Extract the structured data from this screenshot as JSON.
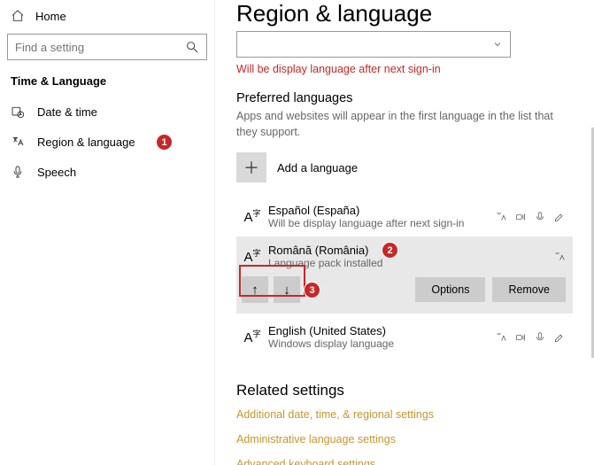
{
  "sidebar": {
    "home": "Home",
    "search_placeholder": "Find a setting",
    "category": "Time & Language",
    "items": [
      {
        "label": "Date & time"
      },
      {
        "label": "Region & language"
      },
      {
        "label": "Speech"
      }
    ]
  },
  "page": {
    "title": "Region & language",
    "dropdown_partial": " ",
    "display_warning": "Will be display language after next sign-in",
    "preferred_title": "Preferred languages",
    "preferred_sub": "Apps and websites will appear in the first language in the list that they support.",
    "add_label": "Add a language",
    "languages": [
      {
        "name": "Español (España)",
        "sub": "Will be display language after next sign-in"
      },
      {
        "name": "Română (România)",
        "sub": "Language pack installed"
      },
      {
        "name": "English (United States)",
        "sub": "Windows display language"
      }
    ],
    "options_btn": "Options",
    "remove_btn": "Remove",
    "related_title": "Related settings",
    "links": [
      "Additional date, time, & regional settings",
      "Administrative language settings",
      "Advanced keyboard settings"
    ]
  },
  "annotations": {
    "b1": "1",
    "b2": "2",
    "b3": "3"
  }
}
